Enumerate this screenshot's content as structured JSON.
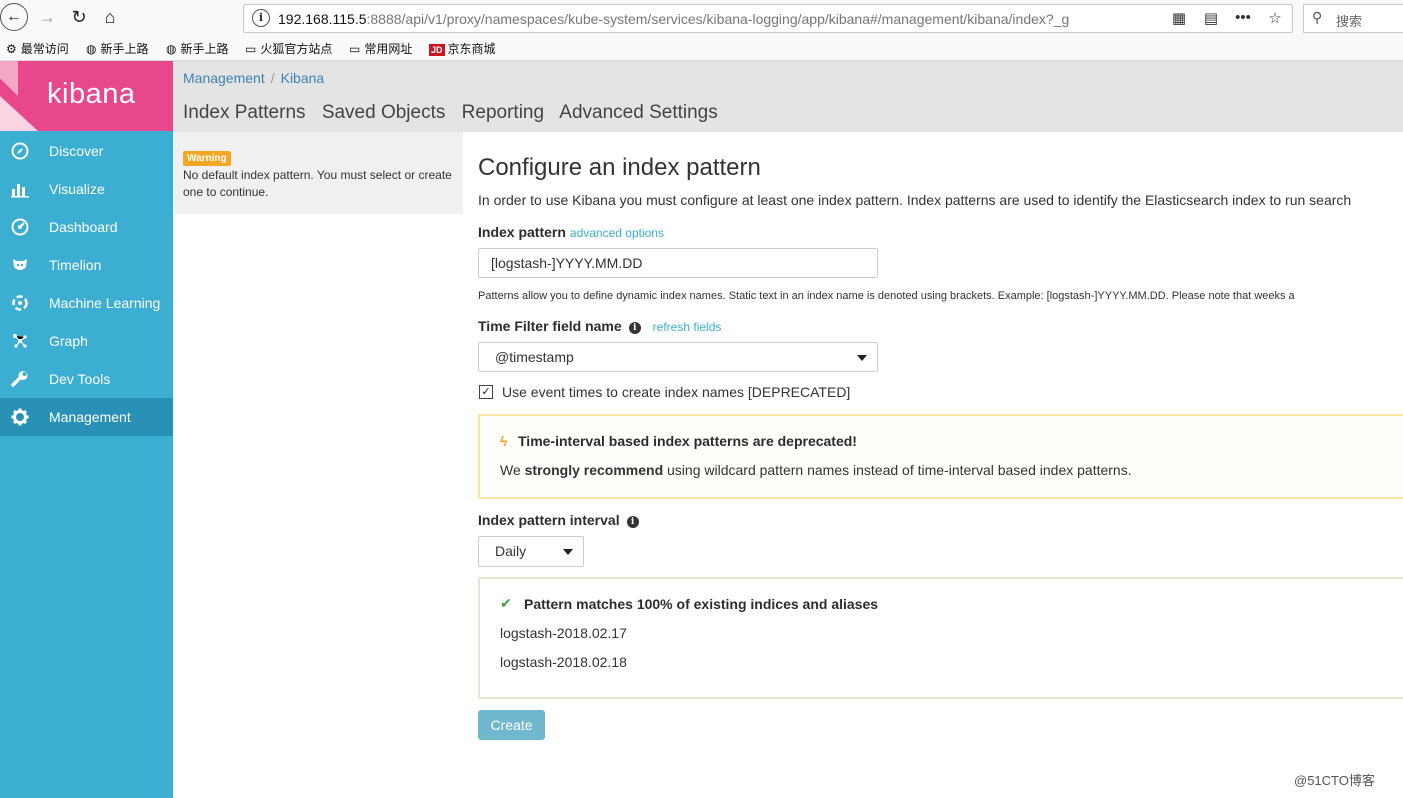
{
  "browser": {
    "back_icon": "←",
    "forward_icon": "→",
    "reload_icon": "↻",
    "home_icon": "⌂",
    "url_host": "192.168.115.5",
    "url_rest": ":8888/api/v1/proxy/namespaces/kube-system/services/kibana-logging/app/kibana#/management/kibana/index?_g",
    "search_placeholder": "搜索",
    "bookmarks": [
      {
        "label": "最常访问",
        "icon": "⚙"
      },
      {
        "label": "新手上路",
        "icon": "◍"
      },
      {
        "label": "新手上路",
        "icon": "◍"
      },
      {
        "label": "火狐官方站点",
        "icon": "▭"
      },
      {
        "label": "常用网址",
        "icon": "▭"
      },
      {
        "label": "京东商城",
        "icon": "JD"
      }
    ]
  },
  "sidebar": {
    "logo_text": "kibana",
    "items": [
      {
        "label": "Discover",
        "icon": "compass-icon"
      },
      {
        "label": "Visualize",
        "icon": "bar-chart-icon"
      },
      {
        "label": "Dashboard",
        "icon": "dashboard-icon"
      },
      {
        "label": "Timelion",
        "icon": "timelion-icon"
      },
      {
        "label": "Machine Learning",
        "icon": "machine-learning-icon"
      },
      {
        "label": "Graph",
        "icon": "graph-icon"
      },
      {
        "label": "Dev Tools",
        "icon": "wrench-icon"
      },
      {
        "label": "Management",
        "icon": "gear-icon",
        "active": true
      }
    ]
  },
  "header": {
    "breadcrumbs": [
      "Management",
      "Kibana"
    ],
    "breadcrumb_sep": "/",
    "tabs": [
      "Index Patterns",
      "Saved Objects",
      "Reporting",
      "Advanced Settings"
    ]
  },
  "warning": {
    "badge": "Warning",
    "text": "No default index pattern. You must select or create one to continue."
  },
  "form": {
    "title": "Configure an index pattern",
    "intro": "In order to use Kibana you must configure at least one index pattern. Index patterns are used to identify the Elasticsearch index to run search",
    "index_pattern_label": "Index pattern",
    "advanced_options_link": "advanced options",
    "index_pattern_value": "[logstash-]YYYY.MM.DD",
    "help_text": "Patterns allow you to define dynamic index names. Static text in an index name is denoted using brackets. Example: [logstash-]YYYY.MM.DD. Please note that weeks a",
    "time_filter_label": "Time Filter field name",
    "refresh_fields_link": "refresh fields",
    "time_field_value": "@timestamp",
    "event_times_checked": true,
    "event_times_label": "Use event times to create index names [DEPRECATED]",
    "deprecation_title": "Time-interval based index patterns are deprecated!",
    "deprecation_prefix": "We ",
    "deprecation_strong": "strongly recommend",
    "deprecation_suffix": " using wildcard pattern names instead of time-interval based index patterns.",
    "interval_label": "Index pattern interval",
    "interval_value": "Daily",
    "match_title": "Pattern matches 100% of existing indices and aliases",
    "matched_indices": [
      "logstash-2018.02.17",
      "logstash-2018.02.18"
    ],
    "create_button": "Create"
  },
  "watermark": "@51CTO博客",
  "colors": {
    "sidebar_bg": "#3caed2",
    "sidebar_active": "#2a91b6",
    "logo_bg": "#e8488b",
    "warning_badge": "#f5a623",
    "link": "#3caed2",
    "create_button": "#70b8cd"
  }
}
